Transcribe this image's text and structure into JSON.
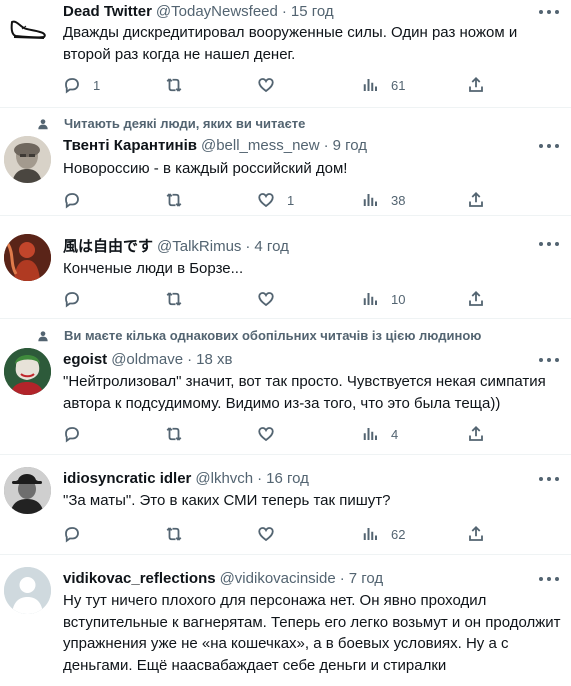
{
  "tweets": [
    {
      "name": "Dead Twitter",
      "handle": "@TodayNewsfeed",
      "time": "15 год",
      "text": "Дважды дискредитировал вооруженные силы. Один раз ножом и\nвторой раз когда не нашел денег.",
      "replies": "1",
      "retweets": "",
      "likes": "",
      "views": "61",
      "avatar_icon": "shoe-drawing-icon"
    },
    {
      "social_context": "Читають деякі люди, яких ви читаєте",
      "name": "Твенті Карантинів",
      "handle": "@bell_mess_new",
      "time": "9 год",
      "text": "Новороссию - в каждый российский дом!",
      "replies": "",
      "retweets": "",
      "likes": "1",
      "views": "38",
      "avatar_icon": "person-portrait-icon"
    },
    {
      "name": "風は自由です",
      "handle": "@TalkRimus",
      "time": "4 год",
      "text": "Конченые люди в Борзе...",
      "replies": "",
      "retweets": "",
      "likes": "",
      "views": "10",
      "avatar_icon": "red-figure-icon"
    },
    {
      "social_context": "Ви маєте кілька однакових обопільних читачів із цією людиною",
      "name": "egoist",
      "handle": "@oldmave",
      "time": "18 хв",
      "text": "\"Нейтролизовал\" значит, вот так просто. Чувствуется некая симпатия\nавтора к подсудимому. Видимо из-за того, что это была теща))",
      "replies": "",
      "retweets": "",
      "likes": "",
      "views": "4",
      "avatar_icon": "joker-portrait-icon"
    },
    {
      "name": "idiosyncratic idler",
      "handle": "@lkhvch",
      "time": "16 год",
      "text": "\"За маты\". Это в каких СМИ теперь так пишут?",
      "replies": "",
      "retweets": "",
      "likes": "",
      "views": "62",
      "avatar_icon": "man-in-hat-icon"
    },
    {
      "name": "vidikovac_reflections",
      "handle": "@vidikovacinside",
      "time": "7 год",
      "text": "Ну тут ничего плохого для персонажа нет. Он явно проходил\nвступительные к вагнерятам. Теперь его легко возьмут и он продолжит\nупражнения уже не «на кошечках», а в боевых условиях. Ну а с\nденьгами. Ещё наасвабаждает себе деньги и стиралки",
      "replies": "",
      "retweets": "",
      "likes": "",
      "views": "",
      "avatar_icon": "default-avatar-icon"
    }
  ],
  "colors": {
    "text": "#0f1419",
    "secondary": "#536471",
    "divider": "#eff3f4"
  }
}
